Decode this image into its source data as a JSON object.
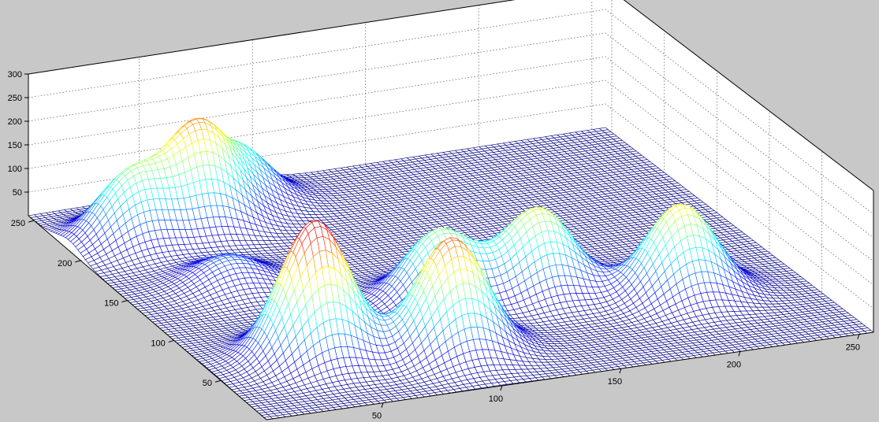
{
  "chart_data": {
    "type": "surface",
    "title": "",
    "xlabel": "",
    "ylabel": "",
    "zlabel": "",
    "xlim": [
      1,
      256
    ],
    "ylim": [
      1,
      256
    ],
    "zlim": [
      0,
      300
    ],
    "grid": true,
    "colormap": "jet",
    "x_ticks": [
      "50",
      "100",
      "150",
      "200",
      "250"
    ],
    "y_ticks": [
      "50",
      "100",
      "150",
      "200",
      "250"
    ],
    "z_ticks": [
      "50",
      "100",
      "150",
      "200",
      "250",
      "300"
    ],
    "peaks": [
      {
        "x": 45,
        "y": 60,
        "height": 290
      },
      {
        "x": 97,
        "y": 45,
        "height": 240
      },
      {
        "x": 205,
        "y": 70,
        "height": 190
      },
      {
        "x": 115,
        "y": 100,
        "height": 150
      },
      {
        "x": 155,
        "y": 95,
        "height": 175
      },
      {
        "x": 45,
        "y": 150,
        "height": 60
      },
      {
        "x": 28,
        "y": 212,
        "height": 140
      },
      {
        "x": 60,
        "y": 218,
        "height": 205
      },
      {
        "x": 85,
        "y": 235,
        "height": 110
      }
    ],
    "background": "#c8c8c8",
    "axes_background": "#ffffff"
  }
}
